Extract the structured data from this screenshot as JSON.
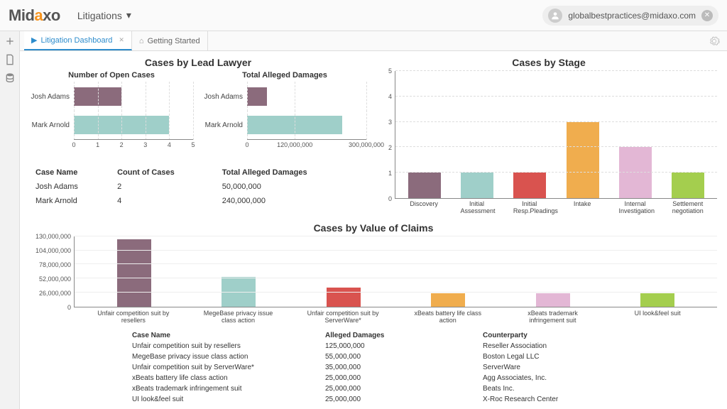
{
  "header": {
    "logo_main": "Mid",
    "logo_accent": "a",
    "logo_suffix": "xo",
    "section": "Litigations",
    "user_email": "globalbestpractices@midaxo.com"
  },
  "tabs": [
    {
      "label": "Litigation Dashboard",
      "active": true,
      "icon": "play"
    },
    {
      "label": "Getting Started",
      "active": false,
      "icon": "home"
    }
  ],
  "lead_lawyer": {
    "title": "Cases by Lead Lawyer",
    "sub1_title": "Number of Open Cases",
    "sub2_title": "Total Alleged Damages",
    "table_headers": [
      "Case Name",
      "Count of Cases",
      "Total Alleged Damages"
    ],
    "rows": [
      {
        "name": "Josh Adams",
        "count": "2",
        "damages": "50,000,000"
      },
      {
        "name": "Mark Arnold",
        "count": "4",
        "damages": "240,000,000"
      }
    ]
  },
  "stage": {
    "title": "Cases by Stage"
  },
  "claims": {
    "title": "Cases by Value of Claims",
    "table_headers": [
      "Case Name",
      "Alleged Damages",
      "Counterparty"
    ],
    "rows": [
      {
        "name": "Unfair competition suit by resellers",
        "dmg": "125,000,000",
        "cp": "Reseller Association"
      },
      {
        "name": "MegeBase privacy issue class action",
        "dmg": "55,000,000",
        "cp": "Boston Legal LLC"
      },
      {
        "name": "Unfair competition suit by ServerWare*",
        "dmg": "35,000,000",
        "cp": "ServerWare"
      },
      {
        "name": "xBeats battery life class action",
        "dmg": "25,000,000",
        "cp": "Agg Associates, Inc."
      },
      {
        "name": "xBeats trademark infringement suit",
        "dmg": "25,000,000",
        "cp": "Beats Inc."
      },
      {
        "name": "UI look&feel suit",
        "dmg": "25,000,000",
        "cp": "X-Roc Research Center"
      }
    ]
  },
  "chart_data": [
    {
      "id": "open_cases",
      "type": "bar",
      "orientation": "horizontal",
      "title": "Number of Open Cases",
      "categories": [
        "Josh Adams",
        "Mark Arnold"
      ],
      "values": [
        2,
        4
      ],
      "xlim": [
        0,
        5
      ],
      "xticks": [
        0,
        1,
        2,
        3,
        4,
        5
      ],
      "colors": [
        "#8B6B7C",
        "#9FCFC9"
      ]
    },
    {
      "id": "alleged_damages",
      "type": "bar",
      "orientation": "horizontal",
      "title": "Total Alleged Damages",
      "categories": [
        "Josh Adams",
        "Mark Arnold"
      ],
      "values": [
        50000000,
        240000000
      ],
      "xlim": [
        0,
        300000000
      ],
      "xticks": [
        0,
        120000000,
        300000000
      ],
      "xtick_labels": [
        "0",
        "120,000,000",
        "300,000,000"
      ],
      "colors": [
        "#8B6B7C",
        "#9FCFC9"
      ]
    },
    {
      "id": "cases_by_stage",
      "type": "bar",
      "orientation": "vertical",
      "title": "Cases by Stage",
      "categories": [
        "Discovery",
        "Initial Assessment",
        "Initial Resp.Pleadings",
        "Intake",
        "Internal Investigation",
        "Settlement negotiation"
      ],
      "values": [
        1,
        1,
        1,
        3,
        2,
        1
      ],
      "ylim": [
        0,
        5
      ],
      "yticks": [
        0,
        1,
        2,
        3,
        4,
        5
      ],
      "colors": [
        "#8B6B7C",
        "#9FCFC9",
        "#D9534F",
        "#F0AD4E",
        "#E3B7D5",
        "#A4CE4E"
      ]
    },
    {
      "id": "cases_by_value",
      "type": "bar",
      "orientation": "vertical",
      "title": "Cases by Value of Claims",
      "categories": [
        "Unfair competition suit by resellers",
        "MegeBase privacy issue class action",
        "Unfair competition suit by ServerWare*",
        "xBeats battery life class action",
        "xBeats trademark infringement suit",
        "UI look&feel suit"
      ],
      "values": [
        125000000,
        55000000,
        35000000,
        25000000,
        25000000,
        25000000
      ],
      "ylim": [
        0,
        130000000
      ],
      "yticks": [
        0,
        26000000,
        52000000,
        78000000,
        104000000,
        130000000
      ],
      "ytick_labels": [
        "0",
        "26,000,000",
        "52,000,000",
        "78,000,000",
        "104,000,000",
        "130,000,000"
      ],
      "colors": [
        "#8B6B7C",
        "#9FCFC9",
        "#D9534F",
        "#F0AD4E",
        "#E3B7D5",
        "#A4CE4E"
      ]
    }
  ]
}
